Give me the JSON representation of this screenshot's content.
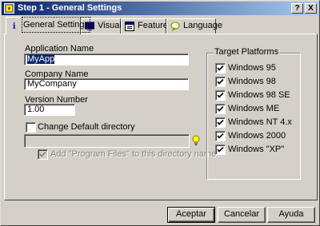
{
  "window": {
    "title": "Step 1 - General Settings",
    "help_button": "?",
    "close_button": "X"
  },
  "tabs": [
    {
      "label": "General Settings",
      "icon": "info-icon",
      "active": true
    },
    {
      "label": "Visual",
      "icon": "monitor-icon",
      "active": false
    },
    {
      "label": "Features",
      "icon": "features-window-icon",
      "active": false
    },
    {
      "label": "Language",
      "icon": "speech-bubble-icon",
      "active": false
    }
  ],
  "form": {
    "app_name_label": "Application Name",
    "app_name_value": "MyApp",
    "company_label": "Company Name",
    "company_value": "MyCompany",
    "version_label": "Version Number",
    "version_value": "1.00",
    "change_dir_label": "Change Default directory",
    "change_dir_checked": false,
    "directory_value": "",
    "add_program_files_label": "Add \"Program Files\" to this directory name",
    "add_program_files_checked": true
  },
  "platforms": {
    "title": "Target Platforms",
    "items": [
      {
        "label": "Windows 95",
        "checked": true
      },
      {
        "label": "Windows 98",
        "checked": true
      },
      {
        "label": "Windows 98 SE",
        "checked": true
      },
      {
        "label": "Windows ME",
        "checked": true
      },
      {
        "label": "Windows NT 4.x",
        "checked": true
      },
      {
        "label": "Windows 2000",
        "checked": true
      },
      {
        "label": "Windows \"XP\"",
        "checked": true
      }
    ]
  },
  "buttons": {
    "accept": "Aceptar",
    "cancel": "Cancelar",
    "help": "Ayuda"
  },
  "colors": {
    "titlebar_start": "#0a246a",
    "titlebar_end": "#a6caf0",
    "face": "#d4d0c8",
    "selection": "#0a246a"
  }
}
